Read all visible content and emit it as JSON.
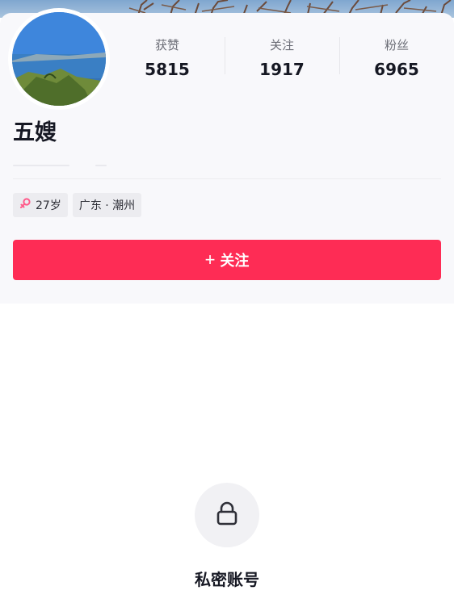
{
  "profile": {
    "name": "五嫂",
    "stats": [
      {
        "label": "获赞",
        "value": "5815"
      },
      {
        "label": "关注",
        "value": "1917"
      },
      {
        "label": "粉丝",
        "value": "6965"
      }
    ],
    "tags": {
      "age": "27岁",
      "location": "广东 · 潮州"
    },
    "follow_label": "关注"
  },
  "private": {
    "label": "私密账号"
  },
  "icons": {
    "gender": "female-icon",
    "follow": "plus-icon",
    "private": "lock-icon"
  },
  "colors": {
    "follow_button": "#fe2c55",
    "gender_icon": "#ff5a8a"
  }
}
